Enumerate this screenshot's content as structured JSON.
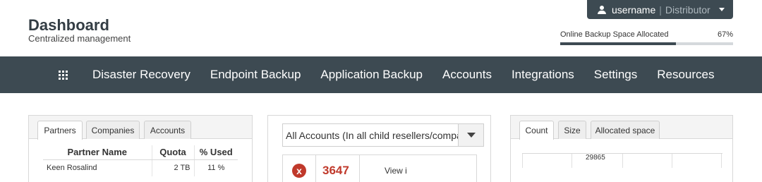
{
  "header": {
    "title": "Dashboard",
    "subtitle": "Centralized management"
  },
  "user": {
    "name": "username",
    "separator": "|",
    "role": "Distributor",
    "icon": "user-icon"
  },
  "backup": {
    "label": "Online Backup Space Allocated",
    "percent_label": "67%",
    "percent": 67
  },
  "nav": {
    "items": [
      {
        "label": "Disaster Recovery"
      },
      {
        "label": "Endpoint Backup"
      },
      {
        "label": "Application Backup"
      },
      {
        "label": "Accounts"
      },
      {
        "label": "Integrations"
      },
      {
        "label": "Settings"
      },
      {
        "label": "Resources"
      }
    ]
  },
  "left_panel": {
    "tabs": [
      {
        "label": "Partners"
      },
      {
        "label": "Companies"
      },
      {
        "label": "Accounts"
      }
    ],
    "columns": [
      "Partner Name",
      "Quota",
      "% Used"
    ],
    "rows": [
      {
        "name": "Keen Rosalind",
        "quota": "2 TB",
        "used": "11 %"
      }
    ]
  },
  "mid_panel": {
    "select_value": "All Accounts (In all child resellers/compan",
    "error_count": "3647",
    "error_icon": "x",
    "view_text": "View i"
  },
  "right_panel": {
    "tabs": [
      {
        "label": "Count"
      },
      {
        "label": "Size"
      },
      {
        "label": "Allocated space"
      }
    ],
    "chart_value": "29865"
  },
  "colors": {
    "navbar": "#3d4a52",
    "error": "#c0392b"
  }
}
